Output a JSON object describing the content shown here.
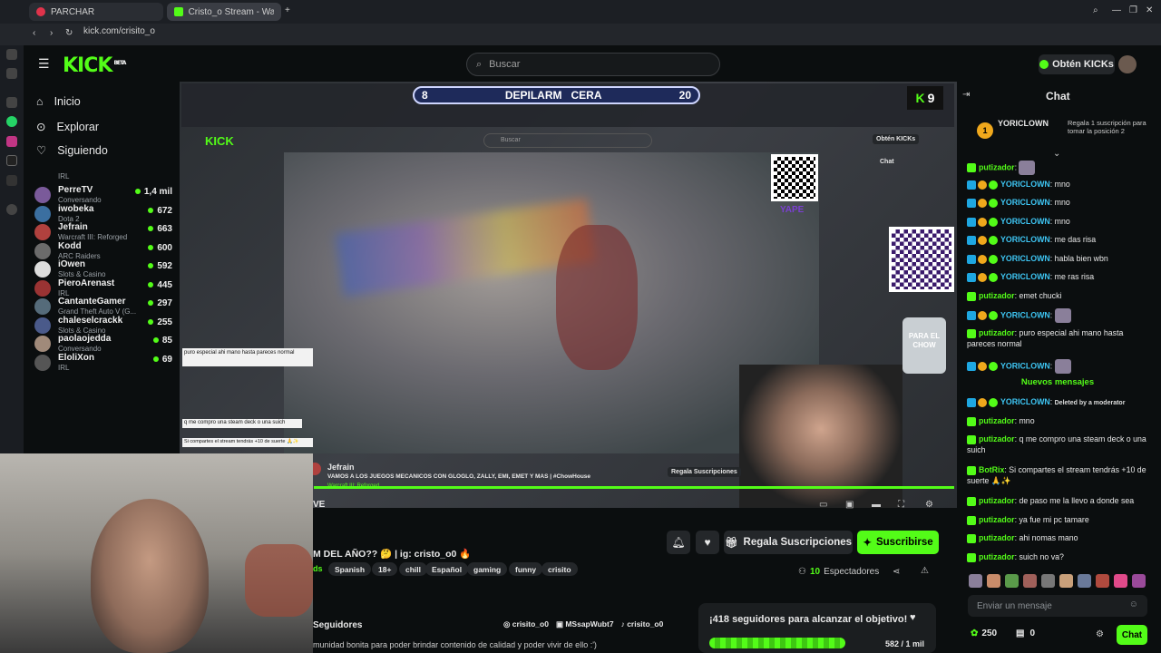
{
  "browser": {
    "tabs": [
      {
        "label": "PARCHAR"
      },
      {
        "label": "Cristo_o Stream - Wat"
      }
    ],
    "url": "kick.com/crisito_o"
  },
  "header": {
    "logo": "KICK",
    "logo_badge": "BETA",
    "search_placeholder": "Buscar",
    "kicks_button": "Obtén KICKs"
  },
  "sidebar": {
    "nav": [
      {
        "label": "Inicio",
        "icon": "home-icon"
      },
      {
        "label": "Explorar",
        "icon": "compass-icon"
      },
      {
        "label": "Siguiendo",
        "icon": "heart-icon"
      }
    ],
    "top_partial": "IRL",
    "channels": [
      {
        "name": "PerreTV",
        "category": "Conversando",
        "viewers": "1,4 mil"
      },
      {
        "name": "iwobeka",
        "category": "Dota 2",
        "viewers": "672"
      },
      {
        "name": "Jefrain",
        "category": "Warcraft III: Reforged",
        "viewers": "663"
      },
      {
        "name": "Kodd",
        "category": "ARC Raiders",
        "viewers": "600"
      },
      {
        "name": "iOwen",
        "category": "Slots & Casino",
        "viewers": "592"
      },
      {
        "name": "PieroArenast",
        "category": "IRL",
        "viewers": "445"
      },
      {
        "name": "CantanteGamer",
        "category": "Grand Theft Auto V (G...",
        "viewers": "297"
      },
      {
        "name": "chaleselcrackk",
        "category": "Slots & Casino",
        "viewers": "255"
      },
      {
        "name": "paolaojedda",
        "category": "Conversando",
        "viewers": "85"
      },
      {
        "name": "EloliXon",
        "category": "IRL",
        "viewers": "69"
      }
    ]
  },
  "stream": {
    "scoreboard": {
      "left": "8",
      "title": "DEPILARM   CERA",
      "right": "20"
    },
    "k_counter": "9",
    "yape": "YAPE",
    "para_chow": "PARA EL CHOW",
    "inner_streamer_name": "Jefrain",
    "inner_title": "VAMOS A LOS JUEGOS MECANICOS CON GLOGLO, ZALLY, EMI, EMET Y MAS | #ChowHouse",
    "inner_category": "Warcraft III: Reforged",
    "inner_gift": "Regala Suscripciones",
    "live_fragment": "VE",
    "inner_search": "Buscar",
    "inner_kicks": "Obtén KICKs",
    "inner_chat_label": "Chat"
  },
  "channel": {
    "title_fragment": "M DEL AÑO?? 🤔 | ig: cristo_o0 🔥",
    "tags_fragment": "ds",
    "tags": [
      "Spanish",
      "18+",
      "chill",
      "Español",
      "gaming",
      "funny",
      "crisito"
    ],
    "gift_button": "Regala Suscripciones",
    "subscribe_button": "Suscribirse",
    "viewers_count": "10",
    "viewers_label": "Espectadores",
    "followers_label": "Seguidores",
    "socials": [
      "crisito_o0",
      "MSsapWubt7",
      "crisito_o0"
    ],
    "bio_fragment": "munidad bonita para poder brindar contenido de calidad y poder vivir de ello :')",
    "goal_text": "¡418 seguidores para alcanzar el objetivo!",
    "goal_progress": "582 / 1 mil",
    "goal_fraction": 0.582
  },
  "chat": {
    "title": "Chat",
    "pinned": {
      "user": "YORICLOWN",
      "text": "Regala 1 suscripción para tomar la posición 2",
      "rank": "1"
    },
    "new_messages_label": "Nuevos mensajes",
    "messages": [
      {
        "user": "putizador",
        "text": "",
        "emote": true,
        "type": "g"
      },
      {
        "user": "YORICLOWN",
        "text": "mno",
        "type": "y"
      },
      {
        "user": "YORICLOWN",
        "text": "mno",
        "type": "y"
      },
      {
        "user": "YORICLOWN",
        "text": "mno",
        "type": "y"
      },
      {
        "user": "YORICLOWN",
        "text": "me das risa",
        "type": "y"
      },
      {
        "user": "YORICLOWN",
        "text": "habla bien wbn",
        "type": "y"
      },
      {
        "user": "YORICLOWN",
        "text": "me ras risa",
        "type": "y"
      },
      {
        "user": "putizador",
        "text": "emet chucki",
        "type": "g"
      },
      {
        "user": "YORICLOWN",
        "text": "",
        "emote": true,
        "type": "y"
      },
      {
        "user": "putizador",
        "text": "puro especial ahi mano hasta pareces normal",
        "type": "g"
      },
      {
        "user": "YORICLOWN",
        "text": "",
        "emote": true,
        "type": "y"
      }
    ],
    "new_messages": [
      {
        "user": "YORICLOWN",
        "text": "Deleted by a moderator",
        "type": "y"
      },
      {
        "user": "putizador",
        "text": "mno",
        "type": "g"
      },
      {
        "user": "putizador",
        "text": "q me compro una steam deck o una suich",
        "type": "g"
      },
      {
        "user": "BotRix",
        "text": "Si compartes el stream tendrás +10 de suerte 🙏✨",
        "type": "g"
      },
      {
        "user": "putizador",
        "text": "de paso me la llevo a donde sea",
        "type": "g"
      },
      {
        "user": "putizador",
        "text": "ya fue mi pc tamare",
        "type": "g"
      },
      {
        "user": "putizador",
        "text": "ahi nomas mano",
        "type": "g"
      },
      {
        "user": "putizador",
        "text": "suich no va?",
        "type": "g"
      }
    ],
    "input_placeholder": "Enviar un mensaje",
    "points": "250",
    "gifts": "0",
    "send_button": "Chat"
  }
}
